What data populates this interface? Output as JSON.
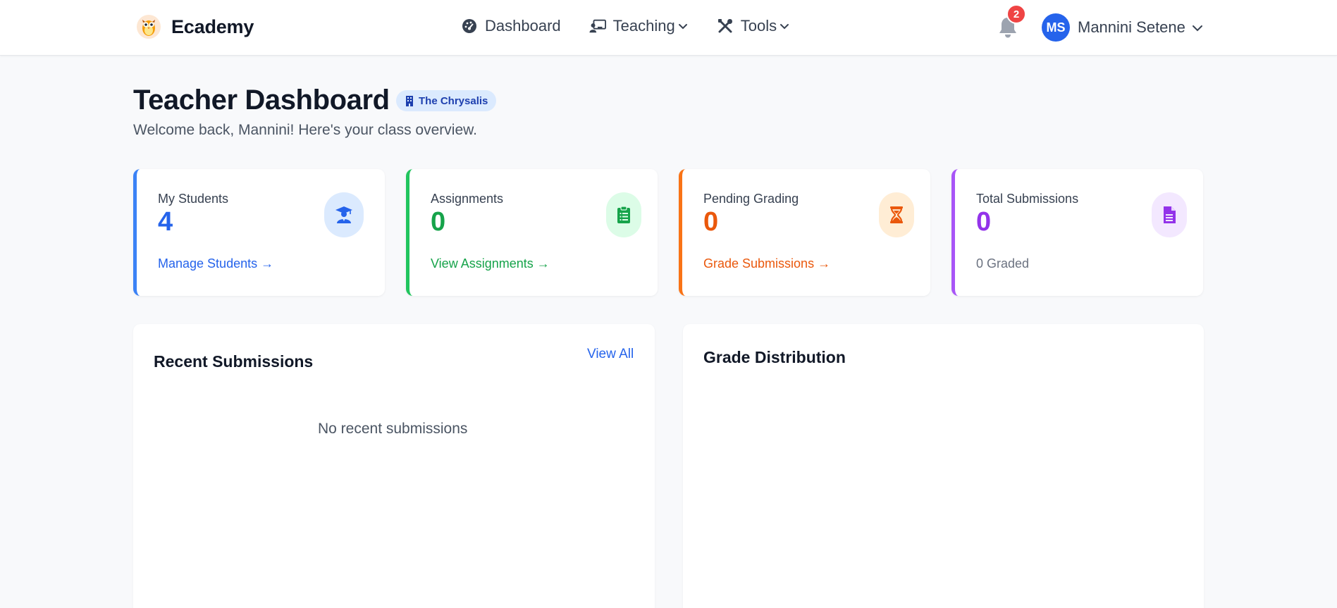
{
  "navbar": {
    "brand": "Ecademy",
    "links": [
      {
        "label": "Dashboard"
      },
      {
        "label": "Teaching"
      },
      {
        "label": "Tools"
      }
    ],
    "notification_count": "2",
    "user": {
      "initials": "MS",
      "name": "Mannini Setene"
    }
  },
  "header": {
    "title": "Teacher Dashboard",
    "school": "The Chrysalis",
    "subtitle": "Welcome back, Mannini! Here's your class overview."
  },
  "stats": [
    {
      "label": "My Students",
      "value": "4",
      "link": "Manage Students →",
      "accent": "#3b82f6",
      "value_color": "#2563eb",
      "icon": "graduate-icon"
    },
    {
      "label": "Assignments",
      "value": "0",
      "link": "View Assignments →",
      "accent": "#22c55e",
      "value_color": "#16a34a",
      "icon": "clipboard-icon"
    },
    {
      "label": "Pending Grading",
      "value": "0",
      "link": "Grade Submissions →",
      "accent": "#f97316",
      "value_color": "#ea580c",
      "icon": "hourglass-icon"
    },
    {
      "label": "Total Submissions",
      "value": "0",
      "foot": "0 Graded",
      "accent": "#a855f7",
      "value_color": "#9333ea",
      "icon": "document-icon"
    }
  ],
  "recent": {
    "title": "Recent Submissions",
    "view_all": "View All",
    "empty": "No recent submissions"
  },
  "grades": {
    "title": "Grade Distribution"
  }
}
